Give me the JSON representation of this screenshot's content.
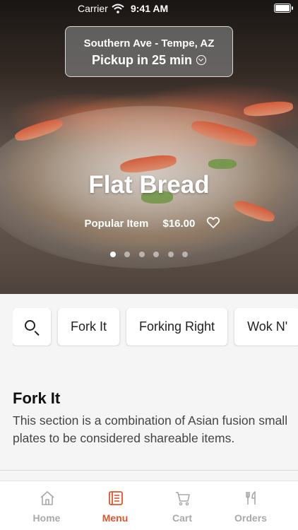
{
  "status_bar": {
    "carrier": "Carrier",
    "time": "9:41 AM"
  },
  "location": {
    "name": "Southern Ave - Tempe, AZ",
    "pickup": "Pickup in 25 min"
  },
  "hero": {
    "title": "Flat Bread",
    "tag": "Popular Item",
    "price": "$16.00",
    "slides_total": 6,
    "active_slide": 1
  },
  "categories": [
    "Fork It",
    "Forking Right",
    "Wok N'"
  ],
  "section": {
    "title": "Fork It",
    "description": "This section is a combination of Asian fusion small plates to be considered shareable items."
  },
  "tabs": [
    {
      "label": "Home",
      "icon": "home-icon",
      "active": false
    },
    {
      "label": "Menu",
      "icon": "menu-icon",
      "active": true
    },
    {
      "label": "Cart",
      "icon": "cart-icon",
      "active": false
    },
    {
      "label": "Orders",
      "icon": "orders-icon",
      "active": false
    }
  ],
  "colors": {
    "accent": "#e0552a",
    "inactive": "#a9a9a9"
  }
}
